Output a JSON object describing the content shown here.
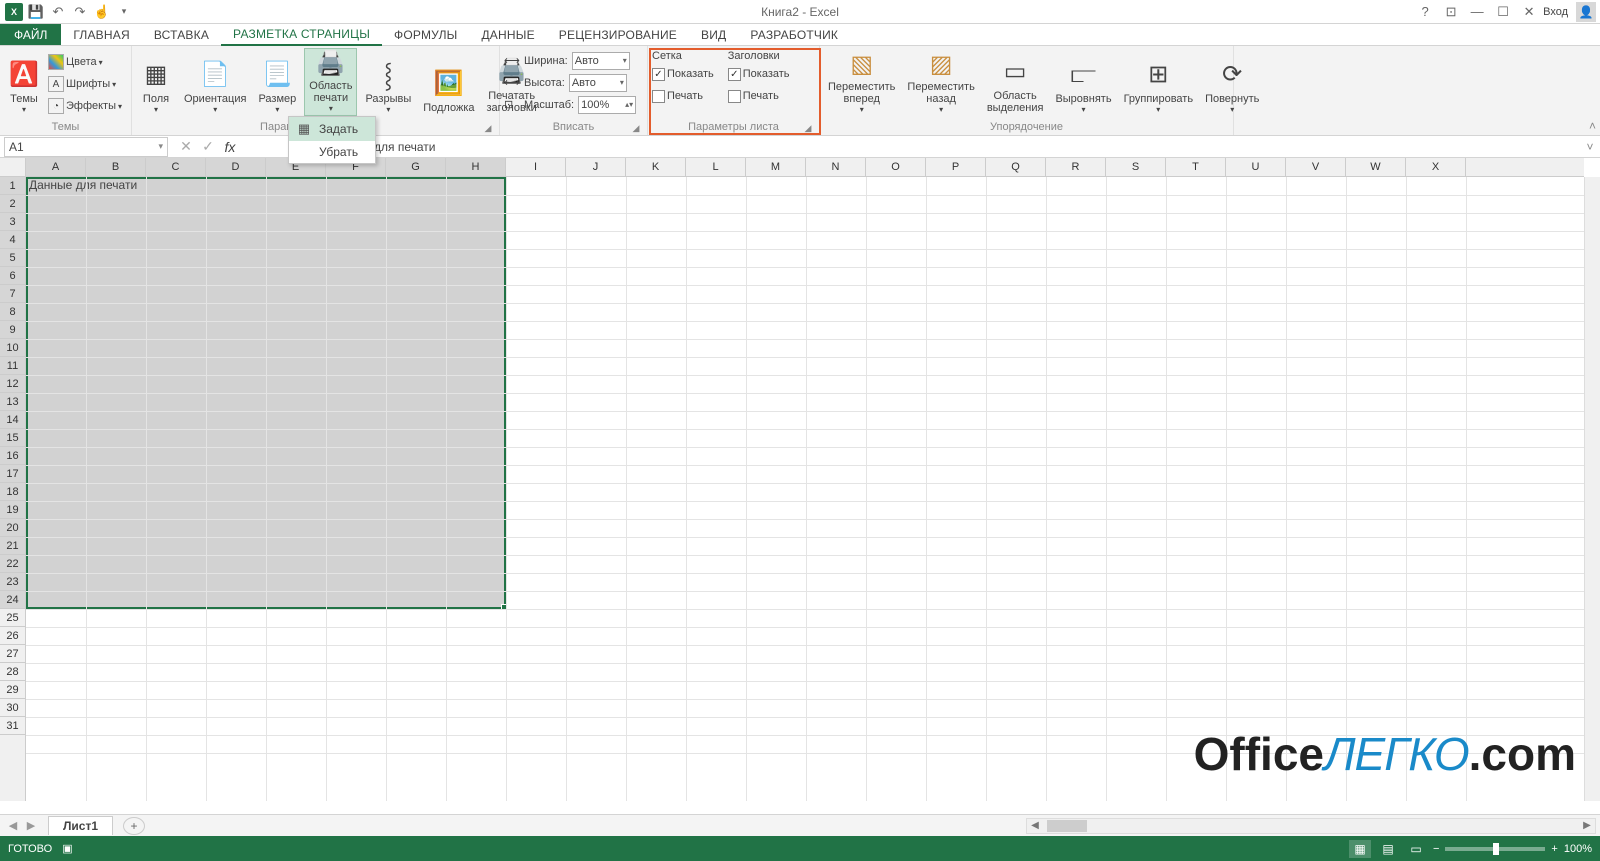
{
  "title": "Книга2 - Excel",
  "signin": "Вход",
  "tabs": {
    "file": "ФАЙЛ",
    "items": [
      "ГЛАВНАЯ",
      "ВСТАВКА",
      "РАЗМЕТКА СТРАНИЦЫ",
      "ФОРМУЛЫ",
      "ДАННЫЕ",
      "РЕЦЕНЗИРОВАНИЕ",
      "ВИД",
      "РАЗРАБОТЧИК"
    ],
    "activeIndex": 2
  },
  "ribbon": {
    "themes": {
      "label": "Темы",
      "btn": "Темы",
      "colors": "Цвета",
      "fonts": "Шрифты",
      "effects": "Эффекты"
    },
    "pagesetup": {
      "label": "Параметры страницы",
      "margins": "Поля",
      "orientation": "Ориентация",
      "size": "Размер",
      "printarea": "Область печати",
      "breaks": "Разрывы",
      "background": "Подложка",
      "printtitles": "Печатать заголовки"
    },
    "popup": {
      "set": "Задать",
      "clear": "Убрать"
    },
    "fit": {
      "label": "Вписать",
      "width": "Ширина:",
      "height": "Высота:",
      "scale": "Масштаб:",
      "auto": "Авто",
      "scaleval": "100%"
    },
    "sheetopts": {
      "label": "Параметры листа",
      "grid": "Сетка",
      "headings": "Заголовки",
      "show": "Показать",
      "print": "Печать"
    },
    "arrange": {
      "label": "Упорядочение",
      "forward": "Переместить вперед",
      "backward": "Переместить назад",
      "selpane": "Область выделения",
      "align": "Выровнять",
      "group": "Группировать",
      "rotate": "Повернуть"
    }
  },
  "namebox": "A1",
  "formulabar_text": "для печати",
  "columns": [
    "A",
    "B",
    "C",
    "D",
    "E",
    "F",
    "G",
    "H",
    "I",
    "J",
    "K",
    "L",
    "M",
    "N",
    "O",
    "P",
    "Q",
    "R",
    "S",
    "T",
    "U",
    "V",
    "W",
    "X"
  ],
  "cell_a1": "Данные для печати",
  "sheet": "Лист1",
  "status": "ГОТОВО",
  "zoom": "100%",
  "watermark": {
    "p1": "Office",
    "p2": "ЛЕГКО",
    "p3": ".com"
  }
}
